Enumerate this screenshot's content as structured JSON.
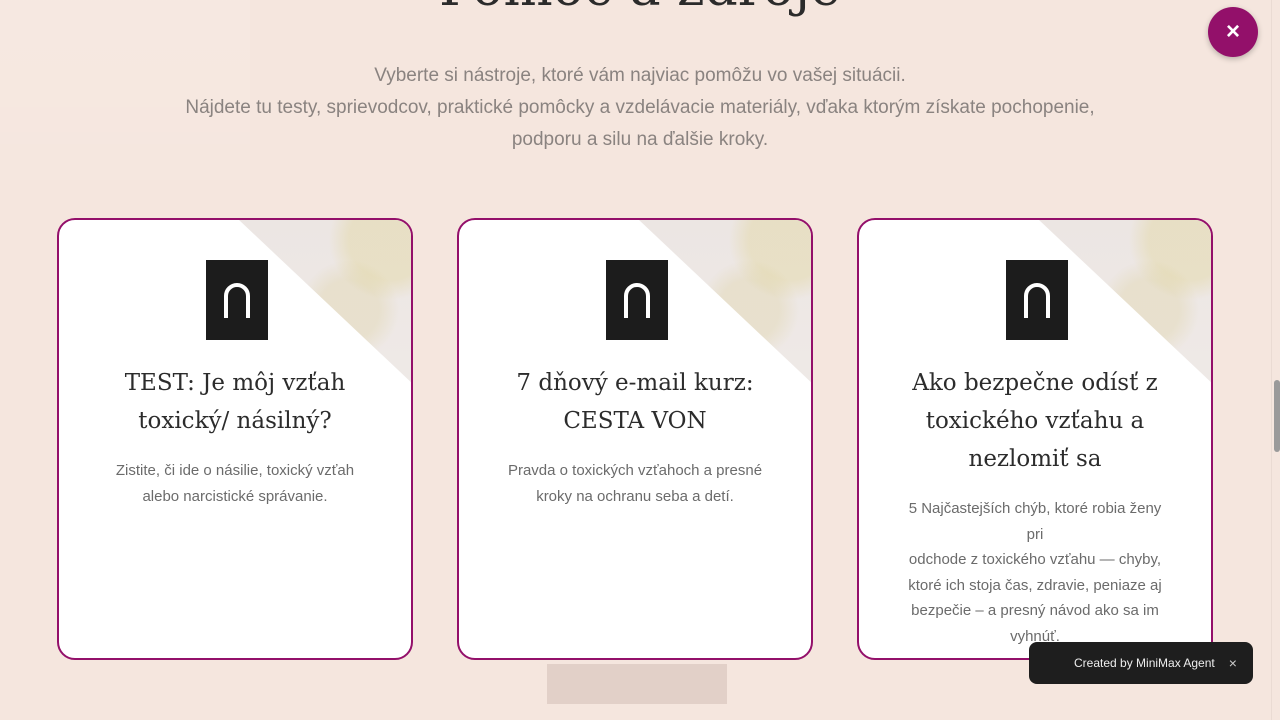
{
  "page": {
    "title": "Pomoc a zdroje",
    "intro_lines": [
      "Vyberte si nástroje, ktoré vám najviac pomôžu vo vašej situácii.",
      "Nájdete tu testy, sprievodcov, praktické pomôcky a vzdelávacie materiály, vďaka ktorým získate pochopenie,",
      "podporu a silu na ďalšie kroky."
    ]
  },
  "cards": [
    {
      "logo_icon": "arch-logo-icon",
      "title_lines": [
        "TEST: Je môj vzťah",
        "toxický/ násilný?"
      ],
      "description_lines": [
        "Zistite, či ide o násilie, toxický vzťah",
        "alebo narcistické správanie."
      ]
    },
    {
      "logo_icon": "arch-logo-icon",
      "title_lines": [
        "7 dňový e-mail kurz:",
        "CESTA VON"
      ],
      "description_lines": [
        "Pravda o toxických vzťahoch a presné",
        "kroky na ochranu seba a detí."
      ]
    },
    {
      "logo_icon": "arch-logo-icon",
      "title_lines": [
        "Ako bezpečne odísť z",
        "toxického vzťahu a",
        "nezlomiť sa"
      ],
      "description_lines": [
        "5 Najčastejších chýb, ktoré robia ženy pri",
        "odchode z toxického vzťahu — chyby,",
        "ktoré ich stoja čas, zdravie, peniaze aj",
        "bezpečie – a presný návod ako sa im",
        "vyhnúť."
      ]
    }
  ],
  "close_button": {
    "label": "×"
  },
  "toast": {
    "text": "Created by MiniMax Agent",
    "close_label": "×"
  },
  "colors": {
    "accent": "#93106a",
    "background": "#f5e6de",
    "card": "#ffffff",
    "logo": "#1c1c1c"
  }
}
